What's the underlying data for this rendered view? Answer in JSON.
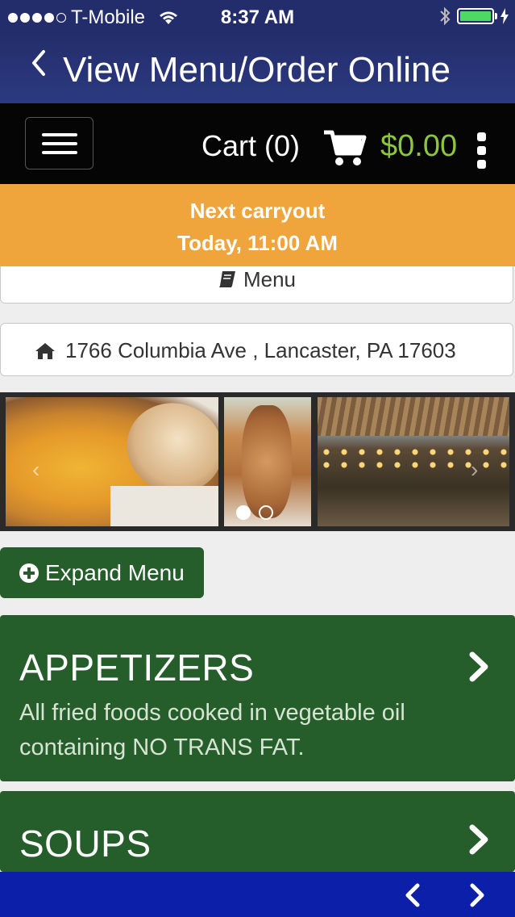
{
  "status_bar": {
    "carrier": "T-Mobile",
    "time": "8:37 AM",
    "signal_bars": 4
  },
  "header": {
    "title": "View Menu/Order Online"
  },
  "navbar": {
    "cart_label": "Cart (0)",
    "cart_total": "$0.00",
    "cart_total_color": "#8cc63f"
  },
  "carryout": {
    "line1": "Next carryout",
    "line2": "Today, 11:00 AM",
    "color": "#f0a43c"
  },
  "menu_box": {
    "label": "Menu"
  },
  "address": {
    "text": "1766 Columbia Ave , Lancaster, PA 17603"
  },
  "carousel": {
    "active_index": 0,
    "total": 2
  },
  "expand_button": {
    "label": "Expand Menu"
  },
  "categories": [
    {
      "name": "APPETIZERS",
      "description": "All fried foods cooked in vegetable oil containing NO TRANS FAT."
    },
    {
      "name": "SOUPS",
      "description": ""
    }
  ],
  "colors": {
    "header_bg": "#232d6b",
    "category_bg": "#255e2a",
    "bottom_bar_bg": "#0c1fa8"
  }
}
